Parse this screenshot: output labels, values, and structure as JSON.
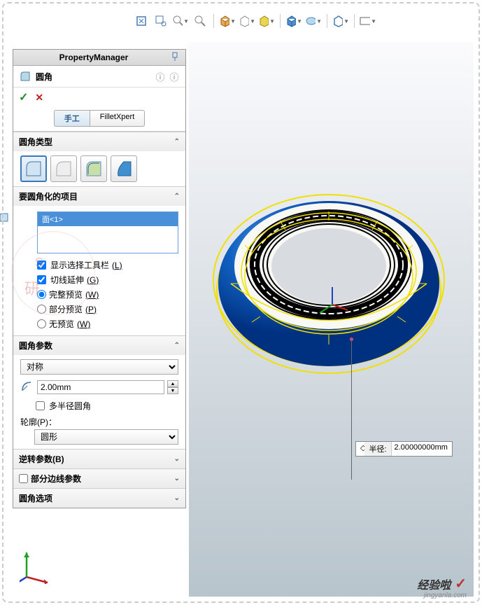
{
  "pm_title": "PropertyManager",
  "feature": {
    "name": "圆角"
  },
  "tabs": {
    "manual": "手工",
    "filletxpert": "FilletXpert"
  },
  "sections": {
    "fillet_type": "圆角类型",
    "items_to_fillet": "要圆角化的项目",
    "fillet_params": "圆角参数",
    "reverse_params": "逆转参数(B)",
    "partial_edge": "部分边线参数",
    "fillet_options": "圆角选项"
  },
  "selection": {
    "item": "面<1>"
  },
  "checkboxes": {
    "show_toolbar": "显示选择工具栏",
    "show_toolbar_key": "(L)",
    "tangent_prop": "切线延伸",
    "tangent_prop_key": "(G)",
    "multi_radius": "多半径圆角"
  },
  "radios": {
    "full_preview": "完整预览",
    "full_preview_key": "(W)",
    "partial_preview": "部分预览",
    "partial_preview_key": "(P)",
    "no_preview": "无预览",
    "no_preview_key": "(W)"
  },
  "params": {
    "symmetry": "对称",
    "radius_value": "2.00mm",
    "profile_label": "轮廓(P)：",
    "profile_value": "圆形"
  },
  "callout": {
    "label": "半径:",
    "value": "2.00000000mm"
  },
  "watermark": {
    "line1": "S",
    "line2": "研",
    "br_logo": "经验啦",
    "br_url": "jingyanla.com"
  }
}
